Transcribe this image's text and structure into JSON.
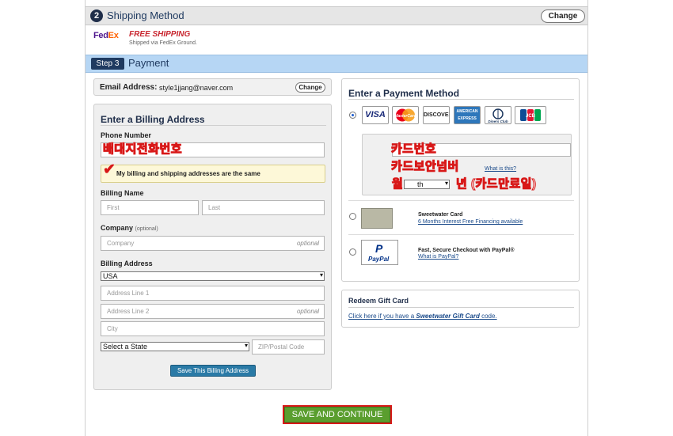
{
  "step2": {
    "number": "2",
    "title": "Shipping Method",
    "change_label": "Change"
  },
  "shipping": {
    "carrier_logo_fe": "Fed",
    "carrier_logo_ex": "Ex",
    "option_label": "FREE SHIPPING",
    "option_detail": "Shipped via FedEx Ground."
  },
  "step3": {
    "badge": "Step 3",
    "title": "Payment"
  },
  "email": {
    "label": "Email Address:",
    "value": "style1jjang@naver.com",
    "change_label": "Change"
  },
  "billing": {
    "title": "Enter a Billing Address",
    "phone_label": "Phone Number",
    "phone_annotation": "배대지전화번호",
    "same_address_label": "My billing and shipping addresses are the same",
    "name_label": "Billing Name",
    "first_placeholder": "First",
    "last_placeholder": "Last",
    "company_label": "Company",
    "company_optional": "(optional)",
    "company_placeholder": "Company",
    "optional_hint": "optional",
    "address_label": "Billing Address",
    "country_value": "USA",
    "line1_placeholder": "Address Line 1",
    "line2_placeholder": "Address Line 2",
    "city_placeholder": "City",
    "state_value": "Select a State",
    "zip_placeholder": "ZIP/Postal Code",
    "save_button": "Save This Billing Address"
  },
  "payment": {
    "title": "Enter a Payment Method",
    "cards": [
      "VISA",
      "MasterCard",
      "DISCOVER",
      "AMERICAN EXPRESS",
      "Diners Club",
      "JCB"
    ],
    "card_number_annotation": "카드번호",
    "cvv_annotation": "카드보안넘버",
    "what_is_this": "What is this?",
    "month_annotation": "월",
    "month_select_value": "th",
    "year_annotation": "년 (카드만료일)",
    "sweetwater_name": "Sweetwater Card",
    "sweetwater_link": "6 Months Interest Free Financing available",
    "paypal_logo_top": "P",
    "paypal_logo_bottom": "PayPal",
    "paypal_name": "Fast, Secure Checkout with PayPal®",
    "paypal_link": "What is PayPal?"
  },
  "gift": {
    "title": "Redeem Gift Card",
    "link_prefix": "Click here if you have a ",
    "link_brand": "Sweetwater Gift Card",
    "link_suffix": " code."
  },
  "continue_button": "SAVE AND CONTINUE",
  "colors": {
    "accent_red": "#d81818",
    "step_blue": "#b6d6f4",
    "continue_green": "#5a9e2e"
  }
}
